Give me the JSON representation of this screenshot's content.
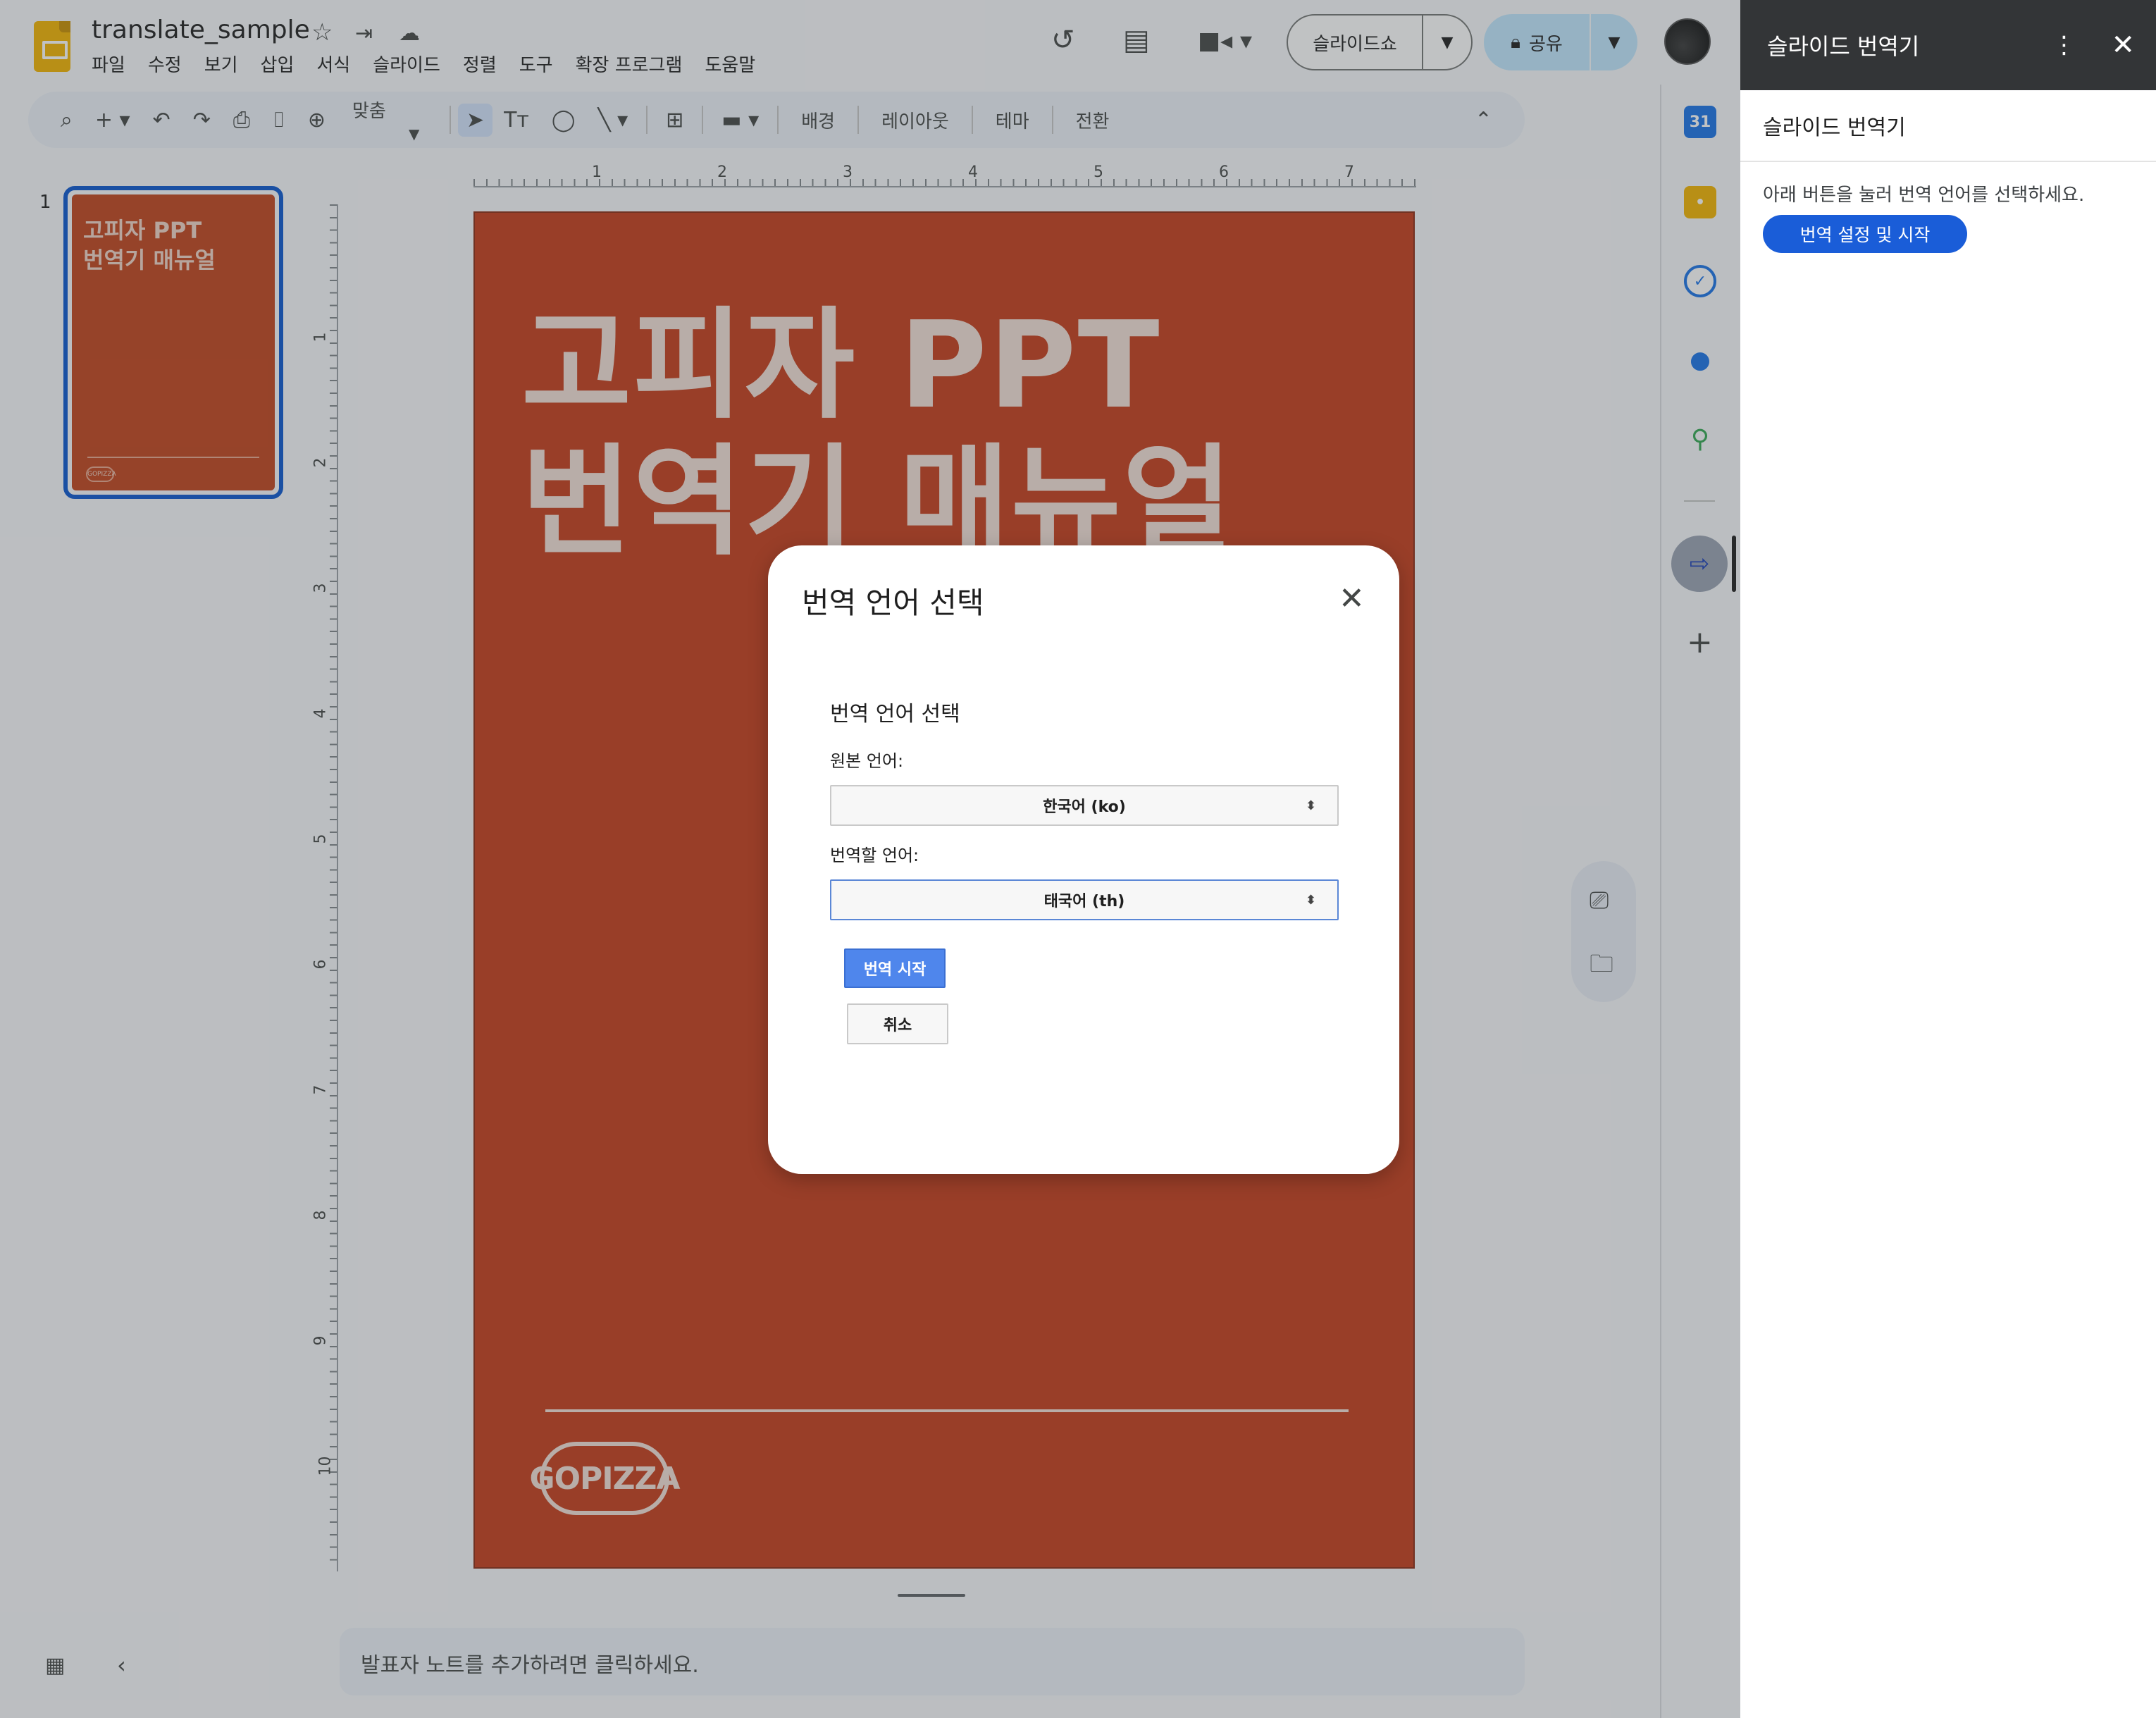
{
  "header": {
    "doc_title": "translate_sample",
    "menu": [
      "파일",
      "수정",
      "보기",
      "삽입",
      "서식",
      "슬라이드",
      "정렬",
      "도구",
      "확장 프로그램",
      "도움말"
    ],
    "slideshow_label": "슬라이드쇼",
    "share_label": "공유"
  },
  "toolbar": {
    "zoom_label": "맞춤",
    "background_label": "배경",
    "layout_label": "레이아웃",
    "theme_label": "테마",
    "transition_label": "전환"
  },
  "ruler": {
    "h_ticks": [
      "1",
      "2",
      "3",
      "4",
      "5",
      "6",
      "7"
    ],
    "v_ticks": [
      "1",
      "2",
      "3",
      "4",
      "5",
      "6",
      "7",
      "8",
      "9",
      "10"
    ]
  },
  "filmstrip": {
    "slide_number": "1",
    "thumb_title": "고피자 PPT\n번역기 매뉴얼",
    "thumb_logo": "GOPIZZA"
  },
  "slide": {
    "title": "고피자 PPT\n번역기 매뉴얼",
    "logo_text": "GOPIZZA",
    "background_color": "#c63d1b"
  },
  "notes": {
    "placeholder": "발표자 노트를 추가하려면 클릭하세요."
  },
  "sidebar": {
    "header_title": "슬라이드 번역기",
    "subtitle": "슬라이드 번역기",
    "description": "아래 버튼을 눌러 번역 언어를 선택하세요.",
    "button_label": "번역 설정 및 시작"
  },
  "modal": {
    "title": "번역 언어 선택",
    "form_heading": "번역 언어 선택",
    "source_label": "원본 언어:",
    "source_value": "한국어 (ko)",
    "target_label": "번역할 언어:",
    "target_value": "태국어 (th)",
    "start_label": "번역 시작",
    "cancel_label": "취소"
  },
  "rail": {
    "calendar_day": "31"
  },
  "colors": {
    "accent": "#0b57d0",
    "share_bg": "#c2e7ff",
    "slide_bg": "#c63d1b",
    "sidebar_header": "#333537"
  }
}
